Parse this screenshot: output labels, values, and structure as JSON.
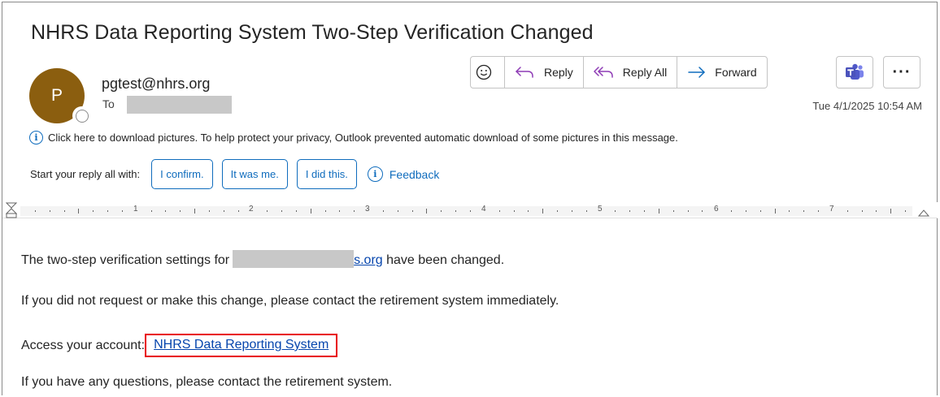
{
  "subject": "NHRS Data Reporting System Two-Step Verification Changed",
  "sender": {
    "avatar_initial": "P",
    "email": "pgtest@nhrs.org",
    "to_label": "To"
  },
  "actions": {
    "reply": "Reply",
    "reply_all": "Reply All",
    "forward": "Forward"
  },
  "timestamp": "Tue 4/1/2025 10:54 AM",
  "info_bar": "Click here to download pictures. To help protect your privacy, Outlook prevented automatic download of some pictures in this message.",
  "suggested_replies": {
    "label": "Start your reply all with:",
    "options": [
      "I confirm.",
      "It was me.",
      "I did this."
    ],
    "feedback": "Feedback"
  },
  "ruler": {
    "numbers": [
      "1",
      "2",
      "3",
      "4",
      "5",
      "6",
      "7"
    ]
  },
  "body": {
    "line1_before": "The two-step verification settings for",
    "line1_link": "s.org",
    "line1_after": " have been changed.",
    "line2": "If you did not request or make this change, please contact the retirement system immediately.",
    "line3_label": "Access your account:",
    "line3_link": "NHRS Data Reporting System",
    "line4": "If you have any questions, please contact the retirement system."
  },
  "colors": {
    "avatar": "#8b5e0f",
    "accent": "#0f6cbd",
    "link": "#0645ad",
    "highlight": "#e8000d"
  }
}
